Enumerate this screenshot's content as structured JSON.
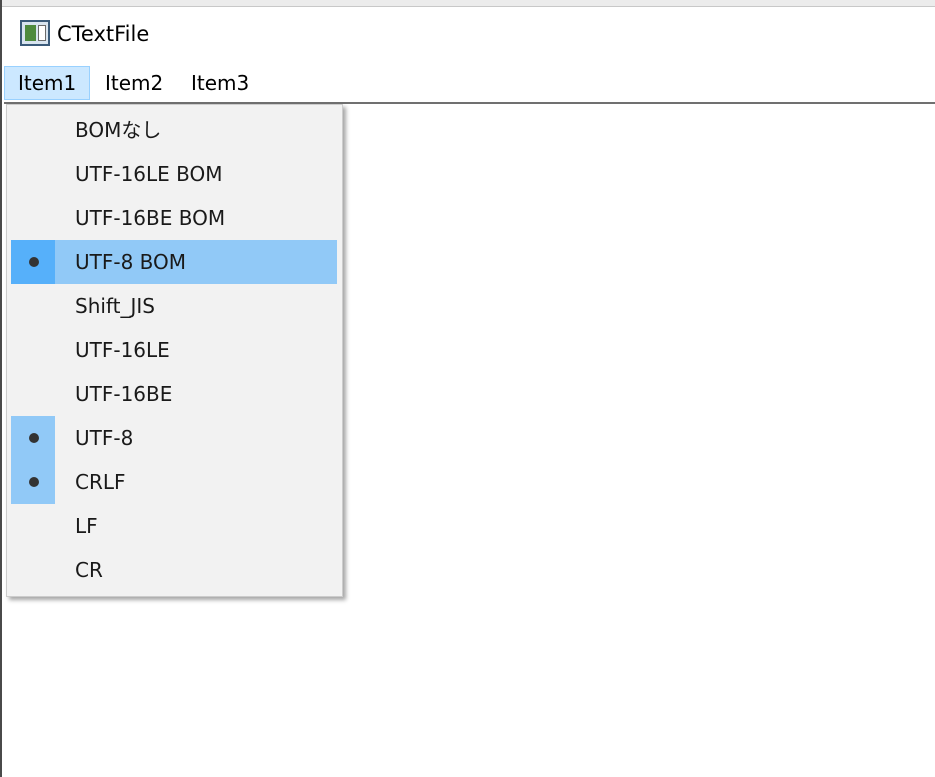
{
  "window": {
    "title": "CTextFile",
    "icon": "app-icon"
  },
  "menubar": {
    "items": [
      {
        "label": "Item1",
        "open": true
      },
      {
        "label": "Item2",
        "open": false
      },
      {
        "label": "Item3",
        "open": false
      }
    ]
  },
  "dropdown": {
    "items": [
      {
        "label": "BOMなし",
        "checked": false,
        "highlighted": false
      },
      {
        "label": "UTF-16LE BOM",
        "checked": false,
        "highlighted": false
      },
      {
        "label": "UTF-16BE BOM",
        "checked": false,
        "highlighted": false
      },
      {
        "label": "UTF-8 BOM",
        "checked": true,
        "highlighted": true
      },
      {
        "label": "Shift_JIS",
        "checked": false,
        "highlighted": false
      },
      {
        "label": "UTF-16LE",
        "checked": false,
        "highlighted": false
      },
      {
        "label": "UTF-16BE",
        "checked": false,
        "highlighted": false
      },
      {
        "label": "UTF-8",
        "checked": true,
        "highlighted": false
      },
      {
        "label": "CRLF",
        "checked": true,
        "highlighted": false
      },
      {
        "label": "LF",
        "checked": false,
        "highlighted": false
      },
      {
        "label": "CR",
        "checked": false,
        "highlighted": false
      }
    ]
  },
  "colors": {
    "highlight": "#91c9f7",
    "check_active": "#56b0fa",
    "menu_open": "#cce8ff"
  }
}
